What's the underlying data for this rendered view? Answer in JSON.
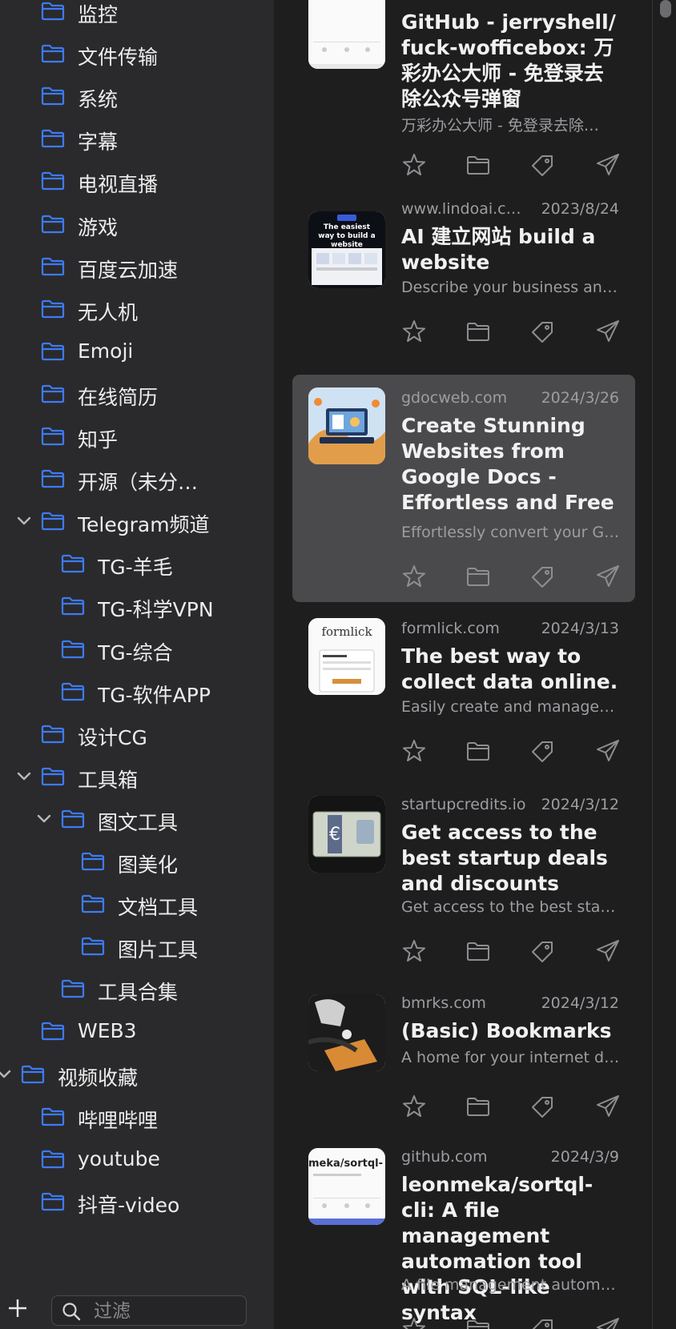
{
  "sidebar": {
    "items": [
      {
        "label": "监控",
        "level": 1,
        "expanded": null
      },
      {
        "label": "文件传输",
        "level": 1,
        "expanded": null
      },
      {
        "label": "系统",
        "level": 1,
        "expanded": null
      },
      {
        "label": "字幕",
        "level": 1,
        "expanded": null
      },
      {
        "label": "电视直播",
        "level": 1,
        "expanded": null
      },
      {
        "label": "游戏",
        "level": 1,
        "expanded": null
      },
      {
        "label": "百度云加速",
        "level": 1,
        "expanded": null
      },
      {
        "label": "无人机",
        "level": 1,
        "expanded": null
      },
      {
        "label": "Emoji",
        "level": 1,
        "expanded": null
      },
      {
        "label": "在线简历",
        "level": 1,
        "expanded": null
      },
      {
        "label": "知乎",
        "level": 1,
        "expanded": null
      },
      {
        "label": "开源（未分…",
        "level": 1,
        "expanded": null
      },
      {
        "label": "Telegram频道",
        "level": 1,
        "expanded": true
      },
      {
        "label": "TG-羊毛",
        "level": 2,
        "expanded": null
      },
      {
        "label": "TG-科学VPN",
        "level": 2,
        "expanded": null
      },
      {
        "label": "TG-综合",
        "level": 2,
        "expanded": null
      },
      {
        "label": "TG-软件APP",
        "level": 2,
        "expanded": null
      },
      {
        "label": "设计CG",
        "level": 1,
        "expanded": null
      },
      {
        "label": "工具箱",
        "level": 1,
        "expanded": true
      },
      {
        "label": "图文工具",
        "level": 2,
        "expanded": true
      },
      {
        "label": "图美化",
        "level": 3,
        "expanded": null
      },
      {
        "label": "文档工具",
        "level": 3,
        "expanded": null
      },
      {
        "label": "图片工具",
        "level": 3,
        "expanded": null
      },
      {
        "label": "工具合集",
        "level": 2,
        "expanded": null
      },
      {
        "label": "WEB3",
        "level": 1,
        "expanded": null
      },
      {
        "label": "视频收藏",
        "level": 0,
        "expanded": true
      },
      {
        "label": "哔哩哔哩",
        "level": 1,
        "expanded": null
      },
      {
        "label": "youtube",
        "level": 1,
        "expanded": null
      },
      {
        "label": "抖音-video",
        "level": 1,
        "expanded": null
      }
    ],
    "footer": {
      "add_icon": "plus-icon",
      "filter_icon": "search-icon",
      "filter_placeholder": "过滤"
    }
  },
  "bookmarks": [
    {
      "domain": "",
      "date": "",
      "title": "GitHub - jerryshell/ fuck-wofficebox: 万彩办公大师 - 免登录去除公众号弹窗",
      "description": "万彩办公大师 - 免登录去除…",
      "thumbnail": "github-card",
      "selected": false
    },
    {
      "domain": "www.lindoai.c…",
      "date": "2023/8/24",
      "title": "AI 建立网站 build a website",
      "description": "Describe your business an…",
      "thumbnail": "site-dark",
      "selected": false
    },
    {
      "domain": "gdocweb.com",
      "date": "2024/3/26",
      "title": "Create Stunning Websites from Google Docs - Effortless and Free",
      "description": "Effortlessly convert your G…",
      "thumbnail": "illustration",
      "selected": true
    },
    {
      "domain": "formlick.com",
      "date": "2024/3/13",
      "title": "The best way to collect data online.",
      "description": "Easily create and manage…",
      "thumbnail": "formlick",
      "selected": false
    },
    {
      "domain": "startupcredits.io",
      "date": "2024/3/12",
      "title": "Get access to the best startup deals and discounts",
      "description": "Get access to the best sta…",
      "thumbnail": "money",
      "selected": false
    },
    {
      "domain": "bmrks.com",
      "date": "2024/3/12",
      "title": "(Basic) Bookmarks",
      "description": "A home for your internet d…",
      "thumbnail": "dark-photo",
      "selected": false
    },
    {
      "domain": "github.com",
      "date": "2024/3/9",
      "title": "leonmeka/sortql-cli: A file management automation tool with SQL-like syntax",
      "description": "A file management automa…",
      "thumbnail": "github-card-2",
      "selected": false
    }
  ],
  "thumb_text": {
    "formlick_logo": "formlick",
    "sortql": "meka/sortql-",
    "lindo_heading": "The easiest way to build a website"
  },
  "actions": [
    "star-icon",
    "folder-icon",
    "tag-icon",
    "share-icon"
  ],
  "colors": {
    "accent": "#3d7bf7",
    "selected_row": "#4a4a4c",
    "sidebar_bg": "#2a2a2c",
    "main_bg": "#1e1e1f"
  }
}
